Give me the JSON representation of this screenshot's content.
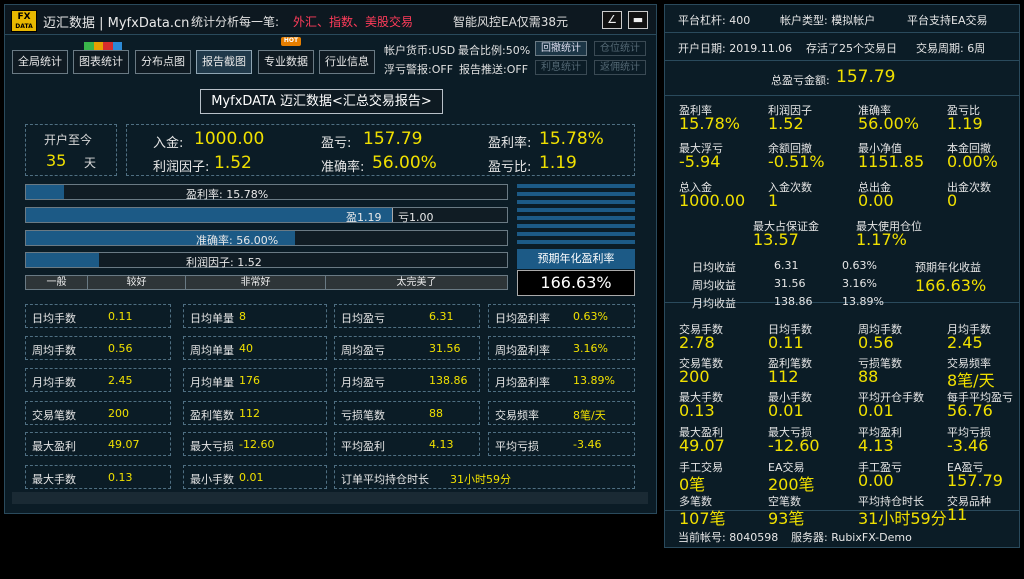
{
  "header": {
    "logo_top": "FX",
    "logo_bottom": "DATA",
    "title": "迈汇数据 | MyfxData.cn",
    "subtitle": "统计分析每一笔:",
    "highlight": "外汇、指数、美股交易",
    "ad": "智能风控EA仅需38元",
    "edit_icon": "∠",
    "min_icon": "▬"
  },
  "nav": {
    "items": [
      "全局统计",
      "图表统计",
      "分布点图",
      "报告截图",
      "专业数据",
      "行业信息"
    ],
    "badge_new": "N E W",
    "badge_hot": "HOT"
  },
  "account_info": {
    "currency": "帐户货币:USD",
    "max_ratio": "最合比例:50%",
    "floating_alert": "浮亏警报:OFF",
    "report_push": "报告推送:OFF"
  },
  "side_buttons": {
    "withdraw_stats": "回撤统计",
    "position_stats": "仓位统计",
    "profit_stats": "利息统计",
    "return_stats": "返佣统计"
  },
  "report_title": "MyfxDATA 迈汇数据<汇总交易报告>",
  "summary": {
    "open_label": "开户至今",
    "days": "35",
    "days_unit": "天",
    "deposit_label": "入金:",
    "deposit": "1000.00",
    "pnl_label": "盈亏:",
    "pnl": "157.79",
    "profit_rate_label": "盈利率:",
    "profit_rate": "15.78%",
    "profit_factor_label": "利润因子:",
    "profit_factor": "1.52",
    "accuracy_label": "准确率:",
    "accuracy": "56.00%",
    "pl_ratio_label": "盈亏比:",
    "pl_ratio": "1.19"
  },
  "bars": {
    "profit_rate": {
      "text": "盈利率: 15.78%",
      "value": 0.1578
    },
    "win_side": "盈1.19",
    "loss_side": "亏1.00",
    "pl_fill": 0.808,
    "accuracy": {
      "text": "准确率: 56.00%",
      "value": 0.56
    },
    "factor": {
      "text": "利润因子: 1.52",
      "value": 0.152
    }
  },
  "scale_labels": [
    "一般",
    "较好",
    "非常好",
    "太完美了"
  ],
  "annual": {
    "label": "预期年化盈利率",
    "value": "166.63%"
  },
  "stats_grid": [
    [
      [
        "日均手数",
        "0.11"
      ],
      [
        "日均单量",
        "8"
      ],
      [
        "日均盈亏",
        "6.31"
      ],
      [
        "日均盈利率",
        "0.63%"
      ]
    ],
    [
      [
        "周均手数",
        "0.56"
      ],
      [
        "周均单量",
        "40"
      ],
      [
        "周均盈亏",
        "31.56"
      ],
      [
        "周均盈利率",
        "3.16%"
      ]
    ],
    [
      [
        "月均手数",
        "2.45"
      ],
      [
        "月均单量",
        "176"
      ],
      [
        "月均盈亏",
        "138.86"
      ],
      [
        "月均盈利率",
        "13.89%"
      ]
    ],
    [
      [
        "交易笔数",
        "200"
      ],
      [
        "盈利笔数",
        "112"
      ],
      [
        "亏损笔数",
        "88"
      ],
      [
        "交易频率",
        "8笔/天"
      ]
    ],
    [
      [
        "最大盈利",
        "49.07"
      ],
      [
        "最大亏损",
        "-12.60"
      ],
      [
        "平均盈利",
        "4.13"
      ],
      [
        "平均亏损",
        "-3.46"
      ]
    ],
    [
      [
        "最大手数",
        "0.13"
      ],
      [
        "最小手数",
        "0.01"
      ],
      [
        "订单平均持仓时长",
        "31小时59分"
      ]
    ]
  ],
  "right": {
    "top": {
      "leverage": "平台杠杆: 400",
      "acct_type": "帐户类型: 模拟帐户",
      "ea_support": "平台支持EA交易",
      "open_date": "开户日期: 2019.11.06",
      "alive": "存活了25个交易日",
      "period": "交易周期: 6周"
    },
    "total_pnl_label": "总盈亏金额:",
    "total_pnl": "157.79",
    "blocks": [
      [
        [
          "盈利率",
          "15.78%"
        ],
        [
          "利润因子",
          "1.52"
        ],
        [
          "准确率",
          "56.00%"
        ],
        [
          "盈亏比",
          "1.19"
        ]
      ],
      [
        [
          "最大浮亏",
          "-5.94"
        ],
        [
          "余额回撤",
          "-0.51%"
        ],
        [
          "最小净值",
          "1151.85"
        ],
        [
          "本金回撤",
          "0.00%"
        ]
      ],
      [
        [
          "总入金",
          "1000.00"
        ],
        [
          "入金次数",
          "1"
        ],
        [
          "总出金",
          "0.00"
        ],
        [
          "出金次数",
          "0"
        ]
      ]
    ],
    "max_margin_label": "最大占保证金",
    "max_margin": "13.57",
    "max_pos_label": "最大使用仓位",
    "max_pos": "1.17%",
    "daily": [
      [
        "日均收益",
        "6.31",
        "0.63%"
      ],
      [
        "周均收益",
        "31.56",
        "3.16%"
      ],
      [
        "月均收益",
        "138.86",
        "13.89%"
      ]
    ],
    "annual_label": "预期年化收益",
    "annual_value": "166.63%",
    "blocks2": [
      [
        [
          "交易手数",
          "2.78"
        ],
        [
          "日均手数",
          "0.11"
        ],
        [
          "周均手数",
          "0.56"
        ],
        [
          "月均手数",
          "2.45"
        ]
      ],
      [
        [
          "交易笔数",
          "200"
        ],
        [
          "盈利笔数",
          "112"
        ],
        [
          "亏损笔数",
          "88"
        ],
        [
          "交易频率",
          "8笔/天"
        ]
      ],
      [
        [
          "最大手数",
          "0.13"
        ],
        [
          "最小手数",
          "0.01"
        ],
        [
          "平均开仓手数",
          "0.01"
        ],
        [
          "每手平均盈亏",
          "56.76"
        ]
      ],
      [
        [
          "最大盈利",
          "49.07"
        ],
        [
          "最大亏损",
          "-12.60"
        ],
        [
          "平均盈利",
          "4.13"
        ],
        [
          "平均亏损",
          "-3.46"
        ]
      ],
      [
        [
          "手工交易",
          "0笔"
        ],
        [
          "EA交易",
          "200笔"
        ],
        [
          "手工盈亏",
          "0.00"
        ],
        [
          "EA盈亏",
          "157.79"
        ]
      ],
      [
        [
          "多笔数",
          "107笔"
        ],
        [
          "空笔数",
          "93笔"
        ],
        [
          "平均持仓时长",
          "31小时59分"
        ],
        [
          "交易品种",
          "11"
        ]
      ]
    ],
    "account": "当前帐号: 8040598",
    "server": "服务器: RubixFX-Demo"
  }
}
